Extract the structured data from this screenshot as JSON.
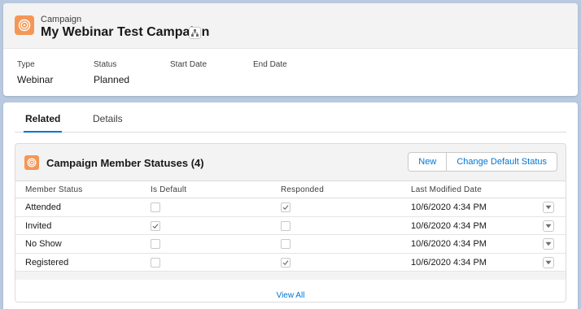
{
  "record": {
    "object_label": "Campaign",
    "title": "My Webinar Test Campaign"
  },
  "fields": [
    {
      "label": "Type",
      "value": "Webinar"
    },
    {
      "label": "Status",
      "value": "Planned"
    },
    {
      "label": "Start Date",
      "value": ""
    },
    {
      "label": "End Date",
      "value": ""
    }
  ],
  "tabs": [
    {
      "label": "Related",
      "active": true
    },
    {
      "label": "Details",
      "active": false
    }
  ],
  "related_list": {
    "title": "Campaign Member Statuses (4)",
    "buttons": {
      "new": "New",
      "change_default": "Change Default Status"
    },
    "columns": [
      "Member Status",
      "Is Default",
      "Responded",
      "Last Modified Date"
    ],
    "rows": [
      {
        "status": "Attended",
        "is_default": false,
        "responded": true,
        "modified": "10/6/2020 4:34 PM"
      },
      {
        "status": "Invited",
        "is_default": true,
        "responded": false,
        "modified": "10/6/2020 4:34 PM"
      },
      {
        "status": "No Show",
        "is_default": false,
        "responded": false,
        "modified": "10/6/2020 4:34 PM"
      },
      {
        "status": "Registered",
        "is_default": false,
        "responded": true,
        "modified": "10/6/2020 4:34 PM"
      }
    ],
    "view_all": "View All"
  },
  "colors": {
    "accent": "#0176d3",
    "campaign_icon": "#f49756"
  }
}
